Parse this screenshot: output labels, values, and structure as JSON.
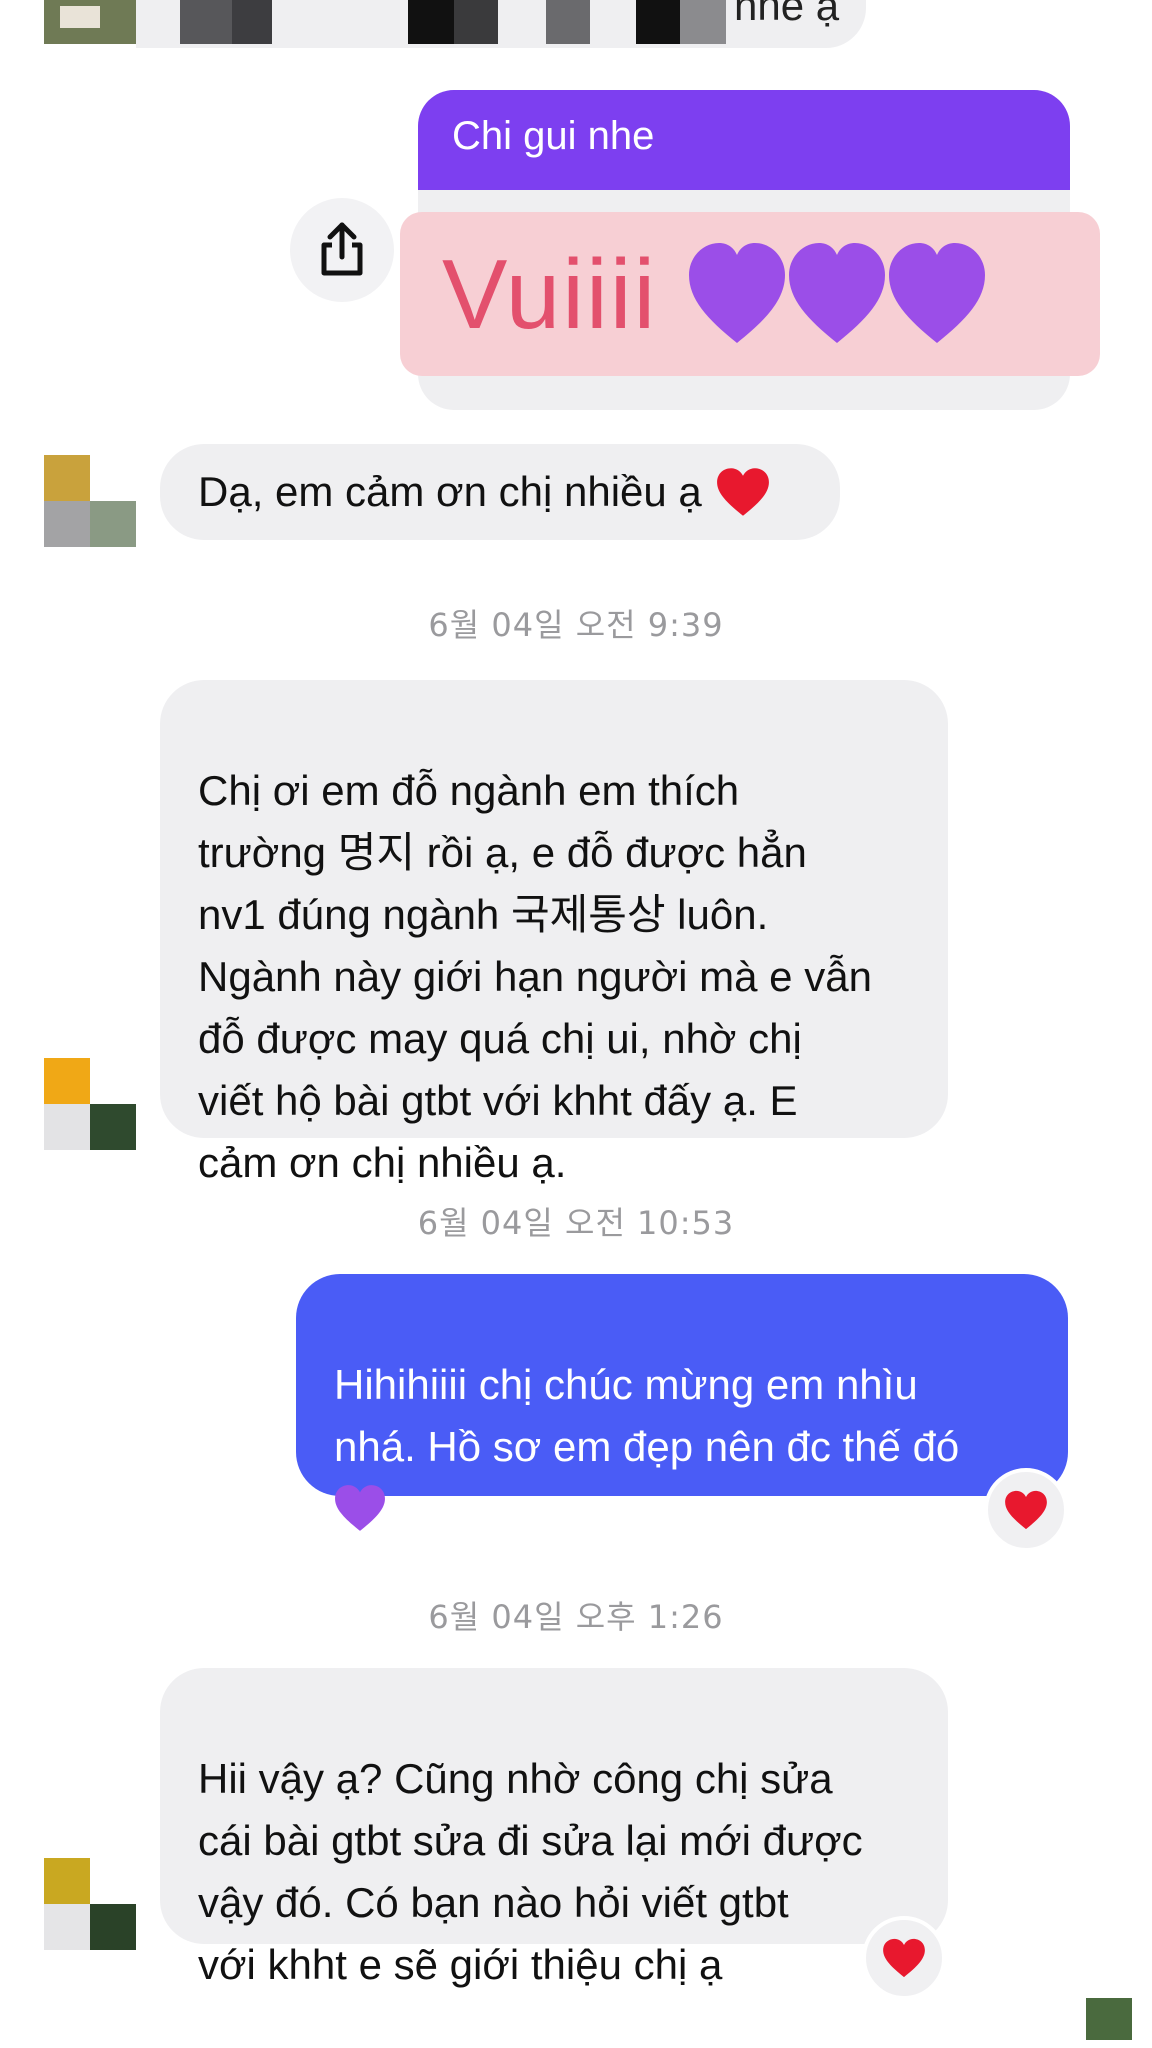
{
  "top_partial": {
    "text": "nhé ạ"
  },
  "shared_post": {
    "header_text": "Chi gui nhe",
    "big_text": "Vuiiii"
  },
  "messages": [
    {
      "id": "m1",
      "side": "received",
      "text": "Dạ, em cảm ơn chị nhiều ạ"
    },
    {
      "id": "m2",
      "side": "received",
      "text": "Chị ơi em đỗ ngành em thích\ntrường 명지 rồi ạ, e đỗ được hẳn\nnv1 đúng ngành 국제통상 luôn.\nNgành này giới hạn người mà e vẫn\nđỗ được may quá chị ui, nhờ chị\nviết hộ bài gtbt với khht đấy ạ. E\ncảm ơn chị nhiều ạ."
    },
    {
      "id": "m3",
      "side": "sent",
      "text": "Hihihiiii chị chúc mừng em nhìu\nnhá. Hồ sơ em đẹp nên đc thế đó"
    },
    {
      "id": "m4",
      "side": "received",
      "text": "Hii vậy ạ? Cũng nhờ công chị sửa\ncái bài gtbt sửa đi sửa lại mới được\nvậy đó. Có bạn nào hỏi viết gtbt\nvới khht e sẽ giới thiệu chị ạ"
    }
  ],
  "timestamps": {
    "t1": "6월 04일 오전 9:39",
    "t2": "6월 04일 오전 10:53",
    "t3": "6월 04일 오후 1:26"
  },
  "colors": {
    "sent_bubble": "#4a5cf6",
    "received_bubble": "#efeff1",
    "post_header": "#7d3ff0",
    "post_pink": "#f7cfd4",
    "vuiii_text": "#e3506d",
    "heart_red": "#e8182e",
    "heart_purple": "#9b4ee8"
  },
  "icons": {
    "share": "share-icon",
    "heart_red": "red-heart-icon",
    "heart_purple": "purple-heart-icon"
  }
}
